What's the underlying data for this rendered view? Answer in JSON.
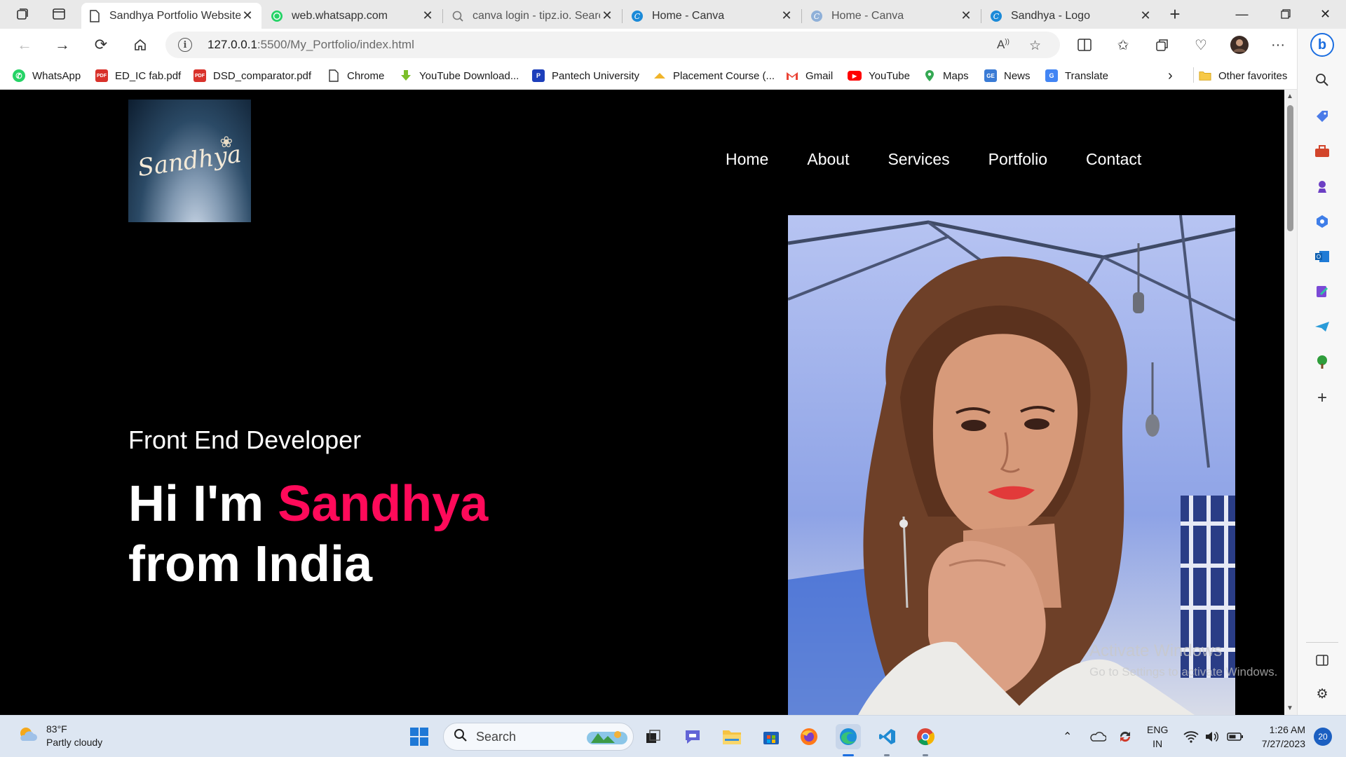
{
  "browser": {
    "tabs": [
      {
        "title": "Sandhya Portfolio Website",
        "active": true,
        "icon": "page-icon"
      },
      {
        "title": "web.whatsapp.com",
        "active": false,
        "icon": "whatsapp-icon"
      },
      {
        "title": "canva login - tipz.io. Search",
        "active": false,
        "icon": "search-icon"
      },
      {
        "title": "Home - Canva",
        "active": false,
        "icon": "canva-icon"
      },
      {
        "title": "Home - Canva",
        "active": false,
        "icon": "canva-icon"
      },
      {
        "title": "Sandhya - Logo",
        "active": false,
        "icon": "canva-icon"
      }
    ],
    "address": {
      "host": "127.0.0.1",
      "path": ":5500/My_Portfolio/index.html"
    },
    "bookmarks": [
      {
        "label": "WhatsApp",
        "icon": "whatsapp-icon",
        "color": "#25d366"
      },
      {
        "label": "ED_IC fab.pdf",
        "icon": "pdf-icon",
        "color": "#d9322b"
      },
      {
        "label": "DSD_comparator.pdf",
        "icon": "pdf-icon",
        "color": "#d9322b"
      },
      {
        "label": "Chrome",
        "icon": "file-icon",
        "color": "#ffffff"
      },
      {
        "label": "YouTube Download...",
        "icon": "download-icon",
        "color": "#7cbf2a"
      },
      {
        "label": "Pantech University",
        "icon": "pantech-icon",
        "color": "#1d3fbb"
      },
      {
        "label": "Placement Course (...",
        "icon": "course-icon",
        "color": "#f0b429"
      },
      {
        "label": "Gmail",
        "icon": "gmail-icon",
        "color": "#ea4335"
      },
      {
        "label": "YouTube",
        "icon": "youtube-icon",
        "color": "#ff0000"
      },
      {
        "label": "Maps",
        "icon": "maps-icon",
        "color": "#34a853"
      },
      {
        "label": "News",
        "icon": "news-icon",
        "color": "#3a7bd5"
      },
      {
        "label": "Translate",
        "icon": "translate-icon",
        "color": "#4285f4"
      }
    ],
    "other_favorites": "Other favorites"
  },
  "site": {
    "logo_text": "Sandhya",
    "nav": [
      "Home",
      "About",
      "Services",
      "Portfolio",
      "Contact"
    ],
    "subtitle": "Front End Developer",
    "title_prefix": "Hi I'm ",
    "title_name": "Sandhya",
    "title_suffix": "from India",
    "accent_color": "#ff0a5a"
  },
  "watermark": {
    "line1": "Activate Windows",
    "line2": "Go to Settings to activate Windows."
  },
  "taskbar": {
    "weather_temp": "83°F",
    "weather_desc": "Partly cloudy",
    "search_placeholder": "Search",
    "lang_1": "ENG",
    "lang_2": "IN",
    "time": "1:26 AM",
    "date": "7/27/2023",
    "notifications": "20"
  }
}
